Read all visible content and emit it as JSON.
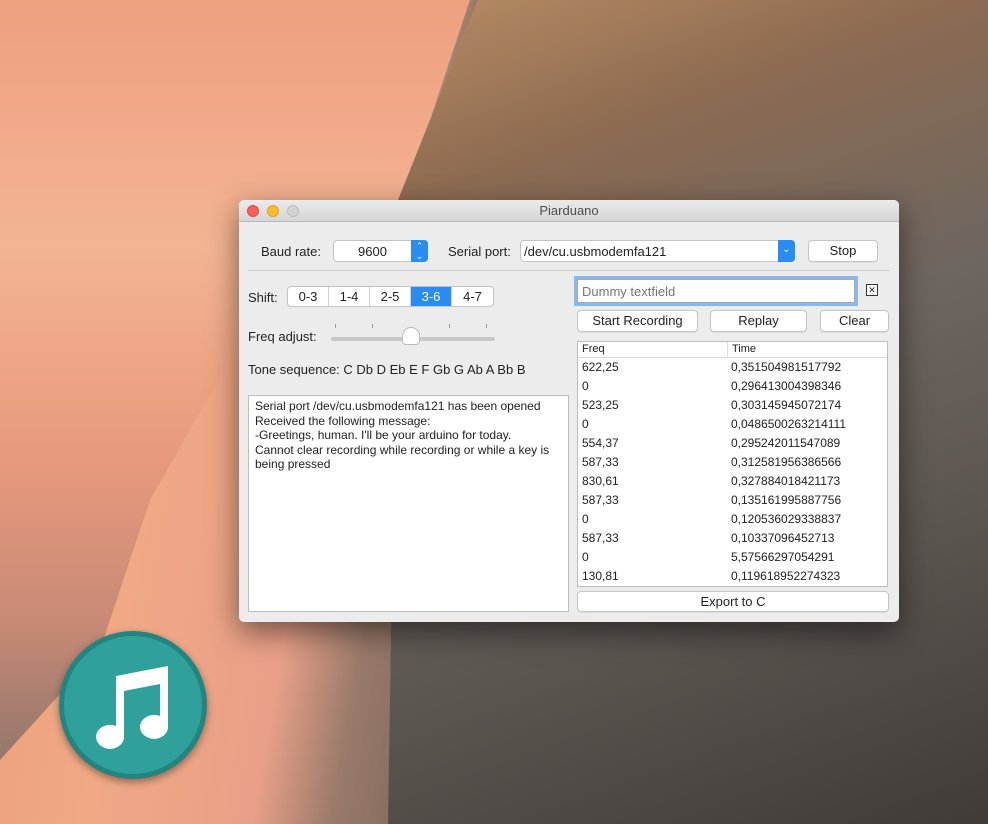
{
  "window": {
    "title": "Piarduano"
  },
  "baud": {
    "label": "Baud rate:",
    "value": "9600"
  },
  "serial": {
    "label": "Serial port:",
    "value": "/dev/cu.usbmodemfa121"
  },
  "stop_label": "Stop",
  "shift": {
    "label": "Shift:",
    "options": [
      "0-3",
      "1-4",
      "2-5",
      "3-6",
      "4-7"
    ],
    "selected": "3-6"
  },
  "freq_adjust": {
    "label": "Freq adjust:",
    "value": 0.5
  },
  "tone_sequence": "Tone sequence: C Db D Eb E F Gb G Ab A Bb B",
  "log": [
    "Serial port /dev/cu.usbmodemfa121 has been opened",
    "Received the following message:",
    "-Greetings, human. I'll be your arduino for today.",
    "Cannot clear recording while recording or while a key is being pressed"
  ],
  "dummy": {
    "placeholder": "Dummy textfield"
  },
  "buttons": {
    "start": "Start Recording",
    "replay": "Replay",
    "clear": "Clear",
    "export": "Export to C"
  },
  "table": {
    "headers": [
      "Freq",
      "Time"
    ],
    "rows": [
      [
        "622,25",
        "0,351504981517792"
      ],
      [
        "0",
        "0,296413004398346"
      ],
      [
        "523,25",
        "0,303145945072174"
      ],
      [
        "0",
        "0,0486500263214111"
      ],
      [
        "554,37",
        "0,295242011547089"
      ],
      [
        "587,33",
        "0,312581956386566"
      ],
      [
        "830,61",
        "0,327884018421173"
      ],
      [
        "587,33",
        "0,135161995887756"
      ],
      [
        "0",
        "0,120536029338837"
      ],
      [
        "587,33",
        "0,10337096452713"
      ],
      [
        "0",
        "5,57566297054291"
      ],
      [
        "130,81",
        "0,119618952274323"
      ]
    ]
  }
}
